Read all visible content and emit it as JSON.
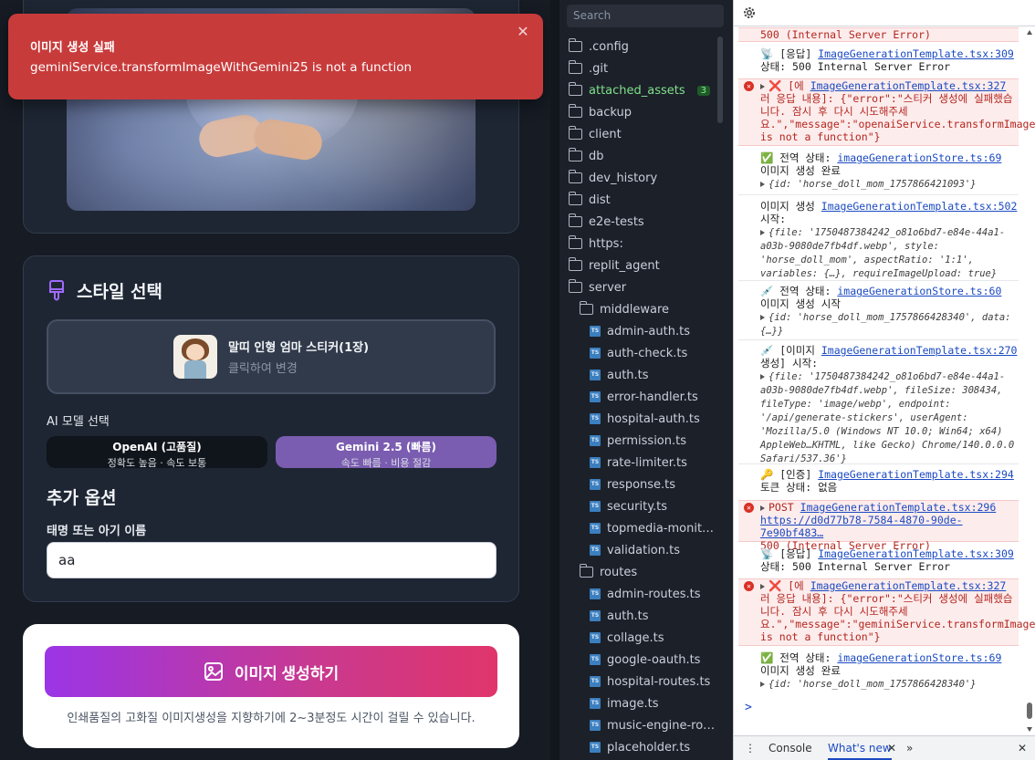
{
  "toast": {
    "title": "이미지 생성 실패",
    "message": "geminiService.transformImageWithGemini25 is not a function",
    "close": "✕"
  },
  "style": {
    "title": "스타일 선택",
    "selected_name": "말띠 인형 엄마 스티커(1장)",
    "selected_hint": "클릭하여 변경"
  },
  "ai": {
    "label": "AI 모델 선택",
    "models": [
      {
        "title": "OpenAI (고품질)",
        "sub": "정확도 높음 · 속도 보통"
      },
      {
        "title": "Gemini 2.5 (빠름)",
        "sub": "속도 빠름 · 비용 절감"
      }
    ]
  },
  "extra": {
    "title": "추가 옵션",
    "baby_label": "태명 또는 아기 이름",
    "baby_value": "aa"
  },
  "generate": {
    "button": "이미지 생성하기",
    "note": "인쇄품질의 고화질 이미지생성을 지향하기에 2~3분정도 시간이 걸릴 수 있습니다."
  },
  "explorer": {
    "search_placeholder": "Search",
    "items": [
      {
        "label": ".config",
        "type": "folder"
      },
      {
        "label": ".git",
        "type": "folder"
      },
      {
        "label": "attached_assets",
        "type": "folder",
        "badge": "3"
      },
      {
        "label": "backup",
        "type": "folder"
      },
      {
        "label": "client",
        "type": "folder"
      },
      {
        "label": "db",
        "type": "folder"
      },
      {
        "label": "dev_history",
        "type": "folder"
      },
      {
        "label": "dist",
        "type": "folder"
      },
      {
        "label": "e2e-tests",
        "type": "folder"
      },
      {
        "label": "https:",
        "type": "folder"
      },
      {
        "label": "replit_agent",
        "type": "folder"
      },
      {
        "label": "server",
        "type": "folder-open"
      },
      {
        "label": "middleware",
        "type": "folder-open"
      },
      {
        "label": "admin-auth.ts",
        "type": "ts"
      },
      {
        "label": "auth-check.ts",
        "type": "ts"
      },
      {
        "label": "auth.ts",
        "type": "ts"
      },
      {
        "label": "error-handler.ts",
        "type": "ts"
      },
      {
        "label": "hospital-auth.ts",
        "type": "ts"
      },
      {
        "label": "permission.ts",
        "type": "ts"
      },
      {
        "label": "rate-limiter.ts",
        "type": "ts"
      },
      {
        "label": "response.ts",
        "type": "ts"
      },
      {
        "label": "security.ts",
        "type": "ts"
      },
      {
        "label": "topmedia-monit…",
        "type": "ts"
      },
      {
        "label": "validation.ts",
        "type": "ts"
      },
      {
        "label": "routes",
        "type": "folder-open"
      },
      {
        "label": "admin-routes.ts",
        "type": "ts"
      },
      {
        "label": "auth.ts",
        "type": "ts"
      },
      {
        "label": "collage.ts",
        "type": "ts"
      },
      {
        "label": "google-oauth.ts",
        "type": "ts"
      },
      {
        "label": "hospital-routes.ts",
        "type": "ts"
      },
      {
        "label": "image.ts",
        "type": "ts"
      },
      {
        "label": "music-engine-ro…",
        "type": "ts"
      },
      {
        "label": "placeholder.ts",
        "type": "ts"
      }
    ]
  },
  "devtools": {
    "top_error": "500 (Internal Server Error)",
    "resp1_tag": "📡 [응답]",
    "resp1_link": "ImageGenerationTemplate.tsx:309",
    "resp1_status": "상태: 500 Internal Server Error",
    "err1_head": "❌ [에",
    "err1_link": "ImageGenerationTemplate.tsx:327",
    "err1_body": "러 응답 내용]: {\"error\":\"스티커 생성에 실패했습니다. 잠시 후 다시 시도해주세요.\",\"message\":\"openaiService.transformImage is not a function\"}",
    "state1_tag": "✅ 전역 상태:",
    "state1_link": "imageGenerationStore.ts:69",
    "state1_text": "이미지 생성 완료",
    "state1_obj": "{id: 'horse_doll_mom_1757866421093'}",
    "gen_start_tag": "이미지 생성",
    "gen_start_link": "ImageGenerationTemplate.tsx:502",
    "gen_start_text": "시작:",
    "gen_start_obj": "{file: '1750487384242_o81o6bd7-e84e-44a1-a03b-9080de7fb4df.webp', style: 'horse_doll_mom', aspectRatio: '1:1', variables: {…}, requireImageUpload: true}",
    "state2_tag": "💉 전역 상태:",
    "state2_link": "imageGenerationStore.ts:60",
    "state2_text": "이미지 생성 시작",
    "state2_obj": "{id: 'horse_doll_mom_1757866428340', data: {…}}",
    "img_start_tag": "💉 [이미지",
    "img_start_link": "ImageGenerationTemplate.tsx:270",
    "img_start_text": "생성] 시작:",
    "img_start_obj": "{file: '1750487384242_o81o6bd7-e84e-44a1-a03b-9080de7fb4df.webp', fileSize: 308434, fileType: 'image/webp', endpoint: '/api/generate-stickers', userAgent: 'Mozilla/5.0 (Windows NT 10.0; Win64; x64) AppleWeb…KHTML, like Gecko) Chrome/140.0.0.0 Safari/537.36'}",
    "auth_tag": "🔑 [인증]",
    "auth_link": "ImageGenerationTemplate.tsx:294",
    "auth_text": "토큰 상태: 없음",
    "post_tag": "POST",
    "post_link": "ImageGenerationTemplate.tsx:296",
    "post_url": "https://d0d77b78-7584-4870-90de-7e90bf483…",
    "post_status": "500 (Internal Server Error)",
    "resp2_tag": "📡 [응답]",
    "resp2_link": "ImageGenerationTemplate.tsx:309",
    "resp2_status": "상태: 500 Internal Server Error",
    "err2_head": "❌ [에",
    "err2_link": "ImageGenerationTemplate.tsx:327",
    "err2_body": "러 응답 내용]: {\"error\":\"스티커 생성에 실패했습니다. 잠시 후 다시 시도해주세요.\",\"message\":\"geminiService.transformImageWithGemini25 is not a function\"}",
    "state3_tag": "✅ 전역 상태:",
    "state3_link": "imageGenerationStore.ts:69",
    "state3_text": "이미지 생성 완료",
    "state3_obj": "{id: 'horse_doll_mom_1757866428340'}",
    "prompt": ">",
    "tab_console": "Console",
    "tab_whatsnew": "What's new"
  }
}
